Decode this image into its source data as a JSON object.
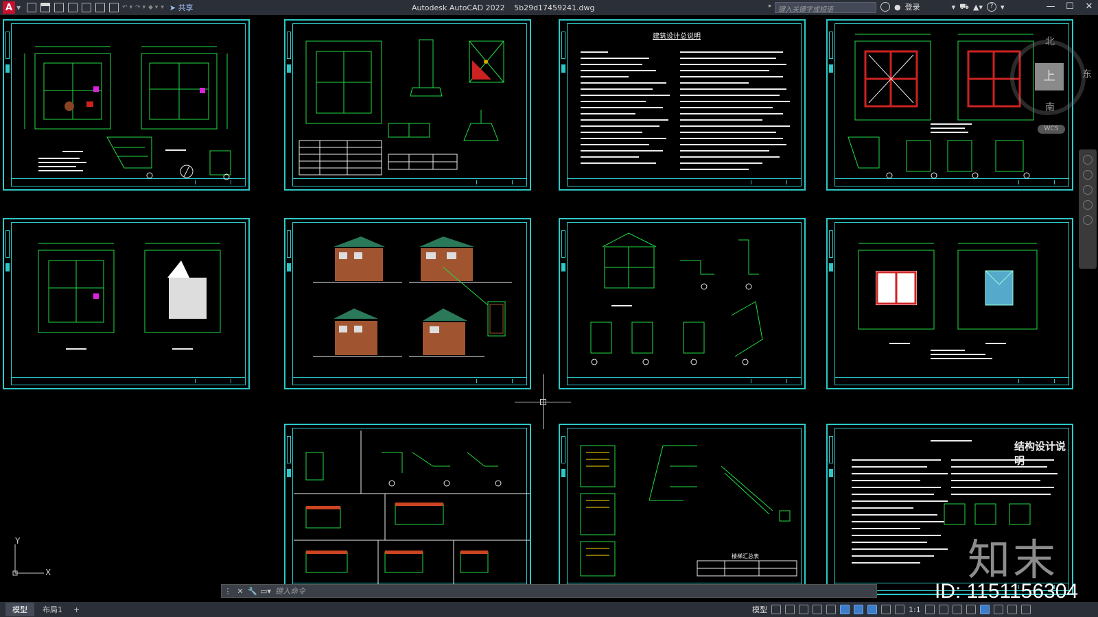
{
  "app": {
    "logo_letter": "A",
    "title": "Autodesk AutoCAD 2022",
    "filename": "5b29d17459241.dwg",
    "share_label": "共享",
    "search_placeholder": "键入关键字或短语",
    "login_label": "登录",
    "help_label": "?"
  },
  "viewcube": {
    "north": "北",
    "east": "东",
    "south": "南",
    "face": "上",
    "wcs": "WCS"
  },
  "ucs": {
    "x": "X",
    "y": "Y"
  },
  "watermark": {
    "logo_text": "知末",
    "id_text": "ID: 1151156304"
  },
  "sheets": [
    {
      "name": "sheet-floorplans-1",
      "title": ""
    },
    {
      "name": "sheet-foundation-details",
      "title": ""
    },
    {
      "name": "sheet-design-notes",
      "title": "建筑设计总说明"
    },
    {
      "name": "sheet-structure-plans",
      "title": ""
    },
    {
      "name": "sheet-floorplans-2",
      "title": ""
    },
    {
      "name": "sheet-elevations",
      "title": ""
    },
    {
      "name": "sheet-sections",
      "title": ""
    },
    {
      "name": "sheet-roof-plans",
      "title": ""
    },
    {
      "name": "sheet-beam-details",
      "title": ""
    },
    {
      "name": "sheet-stair-details",
      "title": "楼梯汇总表"
    },
    {
      "name": "sheet-structure-notes",
      "title": "结构设计说明"
    }
  ],
  "command_line": {
    "placeholder": "键入命令"
  },
  "status_bar": {
    "tabs": [
      "模型",
      "布局1"
    ],
    "add_tab": "+",
    "model_label": "模型",
    "scale_label": "1:1"
  },
  "colors": {
    "sheet_border": "#2ec8c8",
    "linework": "#22dd44",
    "red_fill": "#cc2222",
    "background": "#000000"
  }
}
